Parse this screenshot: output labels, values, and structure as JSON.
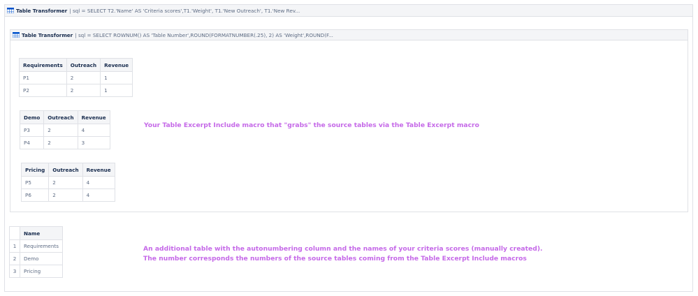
{
  "outer_macro": {
    "title": "Table Transformer",
    "sql": "| sql = SELECT T2.'Name' AS 'Criteria scores',T1.'Weight', T1.'New Outreach', T1.'New Rev..."
  },
  "inner_macro": {
    "title": "Table Transformer",
    "sql": "| sql = SELECT ROWNUM() AS 'Table Number',ROUND(FORMATNUMBER(.25), 2) AS 'Weight',ROUND(F..."
  },
  "tables": [
    {
      "headers": [
        "Requirements",
        "Outreach",
        "Revenue"
      ],
      "rows": [
        [
          "P1",
          "2",
          "1"
        ],
        [
          "P2",
          "2",
          "1"
        ]
      ]
    },
    {
      "headers": [
        "Demo",
        "Outreach",
        "Revenue"
      ],
      "rows": [
        [
          "P3",
          "2",
          "4"
        ],
        [
          "P4",
          "2",
          "3"
        ]
      ]
    },
    {
      "headers": [
        "Pricing",
        "Outreach",
        "Revenue"
      ],
      "rows": [
        [
          "P5",
          "2",
          "4"
        ],
        [
          "P6",
          "2",
          "4"
        ]
      ]
    }
  ],
  "note_inner": "Your Table Excerpt Include macro that \"grabs\" the source tables via the Table Excerpt macro",
  "names_table": {
    "header": "Name",
    "rows": [
      [
        "1",
        "Requirements"
      ],
      [
        "2",
        "Demo"
      ],
      [
        "3",
        "Pricing"
      ]
    ]
  },
  "note_outer_line1": "An additional table with the autonumbering column and the names of your criteria scores (manually created).",
  "note_outer_line2": "The number corresponds the numbers of the source tables coming from the Table Excerpt Include macros",
  "colors": {
    "note": "#c569e8",
    "border": "#dfe1e6",
    "header_bg": "#f4f5f7"
  },
  "icons": {
    "macro": "table-transformer-icon"
  }
}
